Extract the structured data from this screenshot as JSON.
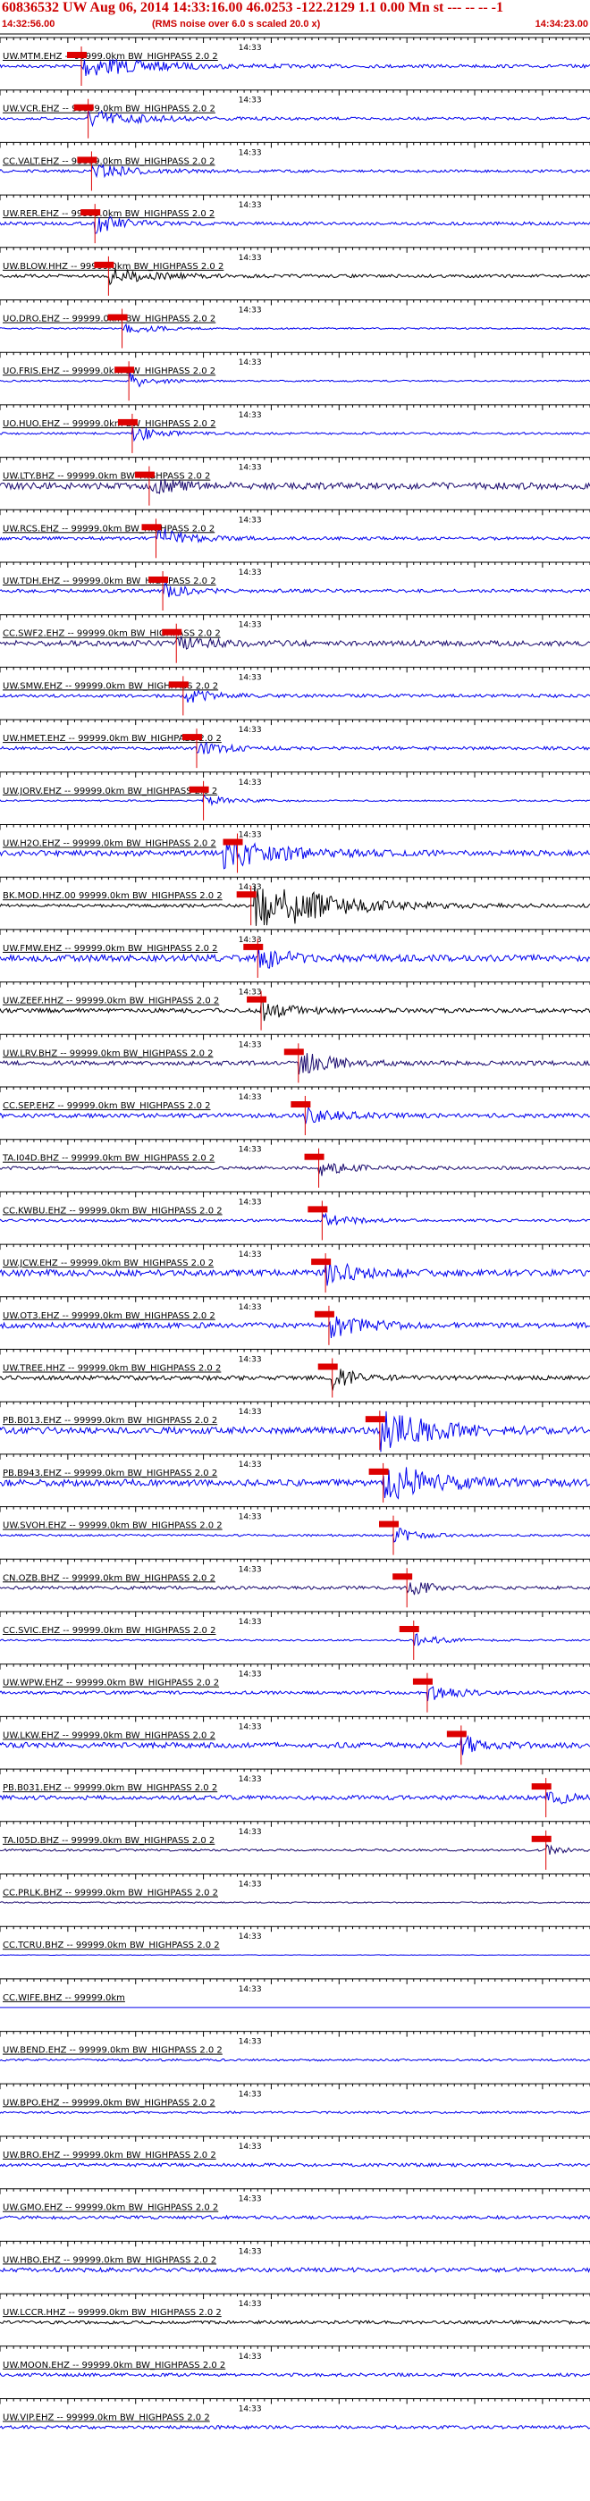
{
  "header": {
    "event_line": "60836532 UW Aug 06, 2014 14:33:16.00   46.0253 -122.2129  1.1 0.00 Mn st --- -- --  -1",
    "start_time": "14:32:56.00",
    "rms_note": "(RMS noise over 6.0 s scaled 20.0 x)",
    "end_time": "14:34:23.00"
  },
  "colors": {
    "header_red": "#cc0000",
    "pick_red": "#dd0000",
    "trace_blue": "#0000ee",
    "trace_navy": "#1a0a6e",
    "trace_black": "#000000"
  },
  "chart_data": {
    "type": "line",
    "title": "60836532 UW Aug 06, 2014 14:33:16.00   46.0253 -122.2129  1.1 0.00 Mn st --- -- --  -1",
    "x_start": "14:32:56.00",
    "x_end": "14:34:23.00",
    "xlim": [
      0,
      87
    ],
    "time_labels": [
      {
        "t": 37,
        "label": "14:33"
      },
      {
        "t": 97,
        "label": "14:34"
      }
    ],
    "grid": false,
    "series": [
      {
        "name": "UW.MTM.EHZ -- 99999.0km BW_HIGHPASS 2.0 2",
        "color": "blue",
        "amplitude": 0.3,
        "pick": 12,
        "onset": 12,
        "energy": 0.9,
        "duration": 22
      },
      {
        "name": "UW.VCR.EHZ -- 99999.0km BW_HIGHPASS 2.0 2",
        "color": "blue",
        "amplitude": 0.25,
        "pick": 13,
        "onset": 13,
        "energy": 0.7,
        "duration": 18
      },
      {
        "name": "CC.VALT.EHZ -- 99999.0km BW_HIGHPASS 2.0 2",
        "color": "blue",
        "amplitude": 0.25,
        "pick": 13.5,
        "onset": 13.5,
        "energy": 0.6,
        "duration": 14
      },
      {
        "name": "UW.RER.EHZ -- 99999.0km BW_HIGHPASS 2.0 2",
        "color": "blue",
        "amplitude": 0.3,
        "pick": 14,
        "onset": 14,
        "energy": 0.7,
        "duration": 12
      },
      {
        "name": "UW.BLOW.HHZ -- 99999.0km BW_HIGHPASS 2.0 2",
        "color": "black",
        "amplitude": 0.3,
        "pick": 16,
        "onset": 16,
        "energy": 0.6,
        "duration": 16
      },
      {
        "name": "UO.DRO.EHZ -- 99999.0km BW_HIGHPASS 2.0 2",
        "color": "blue",
        "amplitude": 0.15,
        "pick": 18,
        "onset": 18,
        "energy": 0.5,
        "duration": 10
      },
      {
        "name": "UO.FRIS.EHZ -- 99999.0km BW_HIGHPASS 2.0 2",
        "color": "blue",
        "amplitude": 0.15,
        "pick": 19,
        "onset": 19,
        "energy": 0.7,
        "duration": 8
      },
      {
        "name": "UO.HUO.EHZ -- 99999.0km BW_HIGHPASS 2.0 2",
        "color": "blue",
        "amplitude": 0.2,
        "pick": 19.5,
        "onset": 19.5,
        "energy": 0.8,
        "duration": 8
      },
      {
        "name": "UW.LTY.BHZ -- 99999.0km BW_HIGHPASS 2.0 2",
        "color": "navy",
        "amplitude": 0.6,
        "pick": 22,
        "onset": 22,
        "energy": 0.5,
        "duration": 12
      },
      {
        "name": "UW.RCS.EHZ -- 99999.0km BW_HIGHPASS 2.0 2",
        "color": "blue",
        "amplitude": 0.3,
        "pick": 23,
        "onset": 23,
        "energy": 0.9,
        "duration": 10
      },
      {
        "name": "UW.TDH.EHZ -- 99999.0km BW_HIGHPASS 2.0 2",
        "color": "blue",
        "amplitude": 0.3,
        "pick": 24,
        "onset": 24,
        "energy": 0.5,
        "duration": 10
      },
      {
        "name": "CC.SWF2.EHZ -- 99999.0km BW_HIGHPASS 2.0 2",
        "color": "navy",
        "amplitude": 0.5,
        "pick": 26,
        "onset": 26,
        "energy": 0.5,
        "duration": 12
      },
      {
        "name": "UW.SMW.EHZ -- 99999.0km BW_HIGHPASS 2.0 2",
        "color": "blue",
        "amplitude": 0.3,
        "pick": 27,
        "onset": 27,
        "energy": 0.6,
        "duration": 10
      },
      {
        "name": "UW.HMET.EHZ -- 99999.0km BW_HIGHPASS 2.0 2",
        "color": "blue",
        "amplitude": 0.3,
        "pick": 29,
        "onset": 29,
        "energy": 0.6,
        "duration": 10
      },
      {
        "name": "UW.JORV.EHZ -- 99999.0km BW_HIGHPASS 2.0 2",
        "color": "blue",
        "amplitude": 0.15,
        "pick": 30,
        "onset": 30,
        "energy": 0.5,
        "duration": 10
      },
      {
        "name": "UW.H2O.EHZ -- 99999.0km BW_HIGHPASS 2.0 2",
        "color": "blue",
        "amplitude": 0.5,
        "pick": 35,
        "onset": 33,
        "energy": 1.1,
        "duration": 20
      },
      {
        "name": "BK.MOD.HHZ.00 99999.0km BW_HIGHPASS 2.0 2",
        "color": "black",
        "amplitude": 0.3,
        "pick": 37,
        "onset": 37,
        "energy": 2.8,
        "duration": 22
      },
      {
        "name": "UW.FMW.EHZ -- 99999.0km BW_HIGHPASS 2.0 2",
        "color": "blue",
        "amplitude": 0.6,
        "pick": 38,
        "onset": 38,
        "energy": 0.8,
        "duration": 12
      },
      {
        "name": "UW.ZEEF.HHZ -- 99999.0km BW_HIGHPASS 2.0 2",
        "color": "black",
        "amplitude": 0.4,
        "pick": 38.5,
        "onset": 38.5,
        "energy": 0.8,
        "duration": 10
      },
      {
        "name": "UW.LRV.BHZ -- 99999.0km BW_HIGHPASS 2.0 2",
        "color": "navy",
        "amplitude": 0.4,
        "pick": 44,
        "onset": 44,
        "energy": 0.9,
        "duration": 12
      },
      {
        "name": "CC.SEP.EHZ -- 99999.0km BW_HIGHPASS 2.0 2",
        "color": "blue",
        "amplitude": 0.4,
        "pick": 45,
        "onset": 45,
        "energy": 0.6,
        "duration": 12
      },
      {
        "name": "TA.I04D.BHZ -- 99999.0km BW_HIGHPASS 2.0 2",
        "color": "navy",
        "amplitude": 0.3,
        "pick": 47,
        "onset": 47,
        "energy": 0.6,
        "duration": 10
      },
      {
        "name": "CC.KWBU.EHZ -- 99999.0km BW_HIGHPASS 2.0 2",
        "color": "blue",
        "amplitude": 0.25,
        "pick": 47.5,
        "onset": 47.5,
        "energy": 0.5,
        "duration": 10
      },
      {
        "name": "UW.JCW.EHZ -- 99999.0km BW_HIGHPASS 2.0 2",
        "color": "blue",
        "amplitude": 0.6,
        "pick": 48,
        "onset": 48,
        "energy": 0.9,
        "duration": 12
      },
      {
        "name": "UW.OT3.EHZ -- 99999.0km BW_HIGHPASS 2.0 2",
        "color": "blue",
        "amplitude": 0.5,
        "pick": 48.5,
        "onset": 48.5,
        "energy": 0.9,
        "duration": 12
      },
      {
        "name": "UW.TREE.HHZ -- 99999.0km BW_HIGHPASS 2.0 2",
        "color": "black",
        "amplitude": 0.4,
        "pick": 49,
        "onset": 49,
        "energy": 0.9,
        "duration": 8
      },
      {
        "name": "PB.B013.EHZ -- 99999.0km BW_HIGHPASS 2.0 2",
        "color": "blue",
        "amplitude": 0.6,
        "pick": 56,
        "onset": 56,
        "energy": 1.7,
        "duration": 18
      },
      {
        "name": "PB.B943.EHZ -- 99999.0km BW_HIGHPASS 2.0 2",
        "color": "blue",
        "amplitude": 0.6,
        "pick": 56.5,
        "onset": 56.5,
        "energy": 1.6,
        "duration": 18
      },
      {
        "name": "UW.SVOH.EHZ -- 99999.0km BW_HIGHPASS 2.0 2",
        "color": "blue",
        "amplitude": 0.2,
        "pick": 58,
        "onset": 58,
        "energy": 0.7,
        "duration": 8
      },
      {
        "name": "CN.OZB.BHZ -- 99999.0km BW_HIGHPASS 2.0 2",
        "color": "navy",
        "amplitude": 0.3,
        "pick": 60,
        "onset": 60,
        "energy": 0.7,
        "duration": 8
      },
      {
        "name": "CC.SVIC.EHZ -- 99999.0km BW_HIGHPASS 2.0 2",
        "color": "blue",
        "amplitude": 0.15,
        "pick": 61,
        "onset": 61,
        "energy": 0.5,
        "duration": 10
      },
      {
        "name": "UW.WPW.EHZ -- 99999.0km BW_HIGHPASS 2.0 2",
        "color": "blue",
        "amplitude": 0.3,
        "pick": 63,
        "onset": 63,
        "energy": 0.6,
        "duration": 10
      },
      {
        "name": "UW.LKW.EHZ -- 99999.0km BW_HIGHPASS 2.0 2",
        "color": "blue",
        "amplitude": 0.5,
        "pick": 68,
        "onset": 68,
        "energy": 0.7,
        "duration": 8
      },
      {
        "name": "PB.B031.EHZ -- 99999.0km BW_HIGHPASS 2.0 2",
        "color": "blue",
        "amplitude": 0.4,
        "pick": 80.5,
        "onset": 80.5,
        "energy": 1.1,
        "duration": 6
      },
      {
        "name": "TA.I05D.BHZ -- 99999.0km BW_HIGHPASS 2.0 2",
        "color": "navy",
        "amplitude": 0.2,
        "pick": 80.5,
        "onset": 80.5,
        "energy": 0.4,
        "duration": 6
      },
      {
        "name": "CC.PRLK.BHZ -- 99999.0km BW_HIGHPASS 2.0 2",
        "color": "navy",
        "amplitude": 0.12,
        "pick": null,
        "onset": 0,
        "energy": 0,
        "duration": 0
      },
      {
        "name": "CC.TCRU.BHZ -- 99999.0km BW_HIGHPASS 2.0 2",
        "color": "blue",
        "amplitude": 0.05,
        "pick": null,
        "onset": 0,
        "energy": 0,
        "duration": 0
      },
      {
        "name": "CC.WIFE.BHZ -- 99999.0km",
        "color": "blue",
        "amplitude": 0.0,
        "pick": null,
        "onset": 0,
        "energy": 0,
        "duration": 0
      },
      {
        "name": "UW.BEND.EHZ -- 99999.0km BW_HIGHPASS 2.0 2",
        "color": "blue",
        "amplitude": 0.2,
        "pick": null,
        "onset": 0,
        "energy": 0,
        "duration": 0
      },
      {
        "name": "UW.BPO.EHZ -- 99999.0km BW_HIGHPASS 2.0 2",
        "color": "blue",
        "amplitude": 0.2,
        "pick": null,
        "onset": 0,
        "energy": 0,
        "duration": 0
      },
      {
        "name": "UW.BRO.EHZ -- 99999.0km BW_HIGHPASS 2.0 2",
        "color": "blue",
        "amplitude": 0.3,
        "pick": null,
        "onset": 0,
        "energy": 0,
        "duration": 0
      },
      {
        "name": "UW.GMO.EHZ -- 99999.0km BW_HIGHPASS 2.0 2",
        "color": "blue",
        "amplitude": 0.3,
        "pick": null,
        "onset": 0,
        "energy": 0,
        "duration": 0
      },
      {
        "name": "UW.HBO.EHZ -- 99999.0km BW_HIGHPASS 2.0 2",
        "color": "blue",
        "amplitude": 0.4,
        "pick": null,
        "onset": 0,
        "energy": 0,
        "duration": 0
      },
      {
        "name": "UW.LCCR.HHZ -- 99999.0km BW_HIGHPASS 2.0 2",
        "color": "black",
        "amplitude": 0.3,
        "pick": null,
        "onset": 0,
        "energy": 0,
        "duration": 0
      },
      {
        "name": "UW.MOON.EHZ -- 99999.0km BW_HIGHPASS 2.0 2",
        "color": "blue",
        "amplitude": 0.3,
        "pick": null,
        "onset": 0,
        "energy": 0,
        "duration": 0
      },
      {
        "name": "UW.VIP.EHZ -- 99999.0km BW_HIGHPASS 2.0 2",
        "color": "blue",
        "amplitude": 0.3,
        "pick": null,
        "onset": 0,
        "energy": 0,
        "duration": 0
      }
    ]
  }
}
